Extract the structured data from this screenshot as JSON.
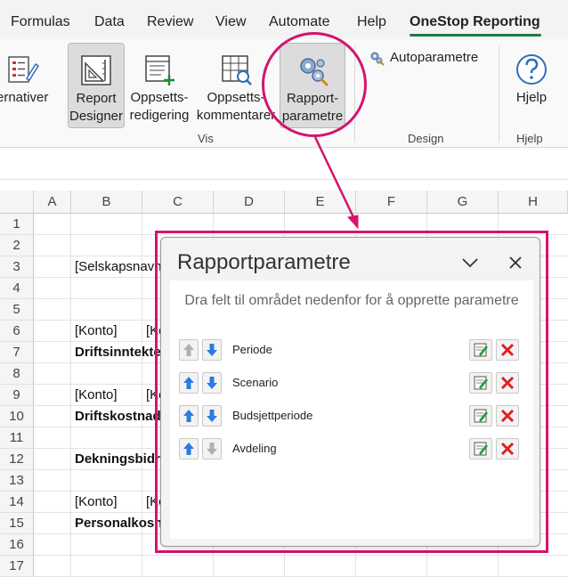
{
  "ribbon": {
    "tabs": [
      "Formulas",
      "Data",
      "Review",
      "View",
      "Automate",
      "Help",
      "OneStop Reporting"
    ],
    "buttons": {
      "alternatives": "ernativer",
      "report_designer": "Report\nDesigner",
      "oppsett_redigering": "Oppsetts-\nredigering",
      "oppsett_kommentarer": "Oppsetts-\nkommentarer",
      "rapport_parametre": "Rapport-\nparametre",
      "autoparametre": "Autoparametre",
      "hjelp": "Hjelp"
    },
    "groups": {
      "vis": "Vis",
      "design": "Design",
      "hjelp": "Hjelp"
    },
    "accent": "#1f7a44"
  },
  "grid": {
    "columns": [
      "A",
      "B",
      "C",
      "D",
      "E",
      "F",
      "G",
      "H"
    ],
    "rows": [
      "1",
      "2",
      "3",
      "4",
      "5",
      "6",
      "7",
      "8",
      "9",
      "10",
      "11",
      "12",
      "13",
      "14",
      "15",
      "16",
      "17"
    ],
    "cells": {
      "b3": "[Selskapsnavn",
      "b6": "[Konto]",
      "c6": "[Ko",
      "b7": "Driftsinntekte",
      "b9": "[Konto]",
      "c9": "[Ko",
      "b10": "Driftskostnad",
      "b12": "Dekningsbidr",
      "b14": "[Konto]",
      "c14": "[Ko",
      "b15": "Personalkosn"
    }
  },
  "panel": {
    "title": "Rapportparametre",
    "hint": "Dra felt til området nedenfor for å opprette parametre",
    "params": [
      {
        "label": "Periode",
        "up_enabled": false,
        "down_enabled": true
      },
      {
        "label": "Scenario",
        "up_enabled": true,
        "down_enabled": true
      },
      {
        "label": "Budsjettperiode",
        "up_enabled": true,
        "down_enabled": true
      },
      {
        "label": "Avdeling",
        "up_enabled": true,
        "down_enabled": false
      }
    ]
  },
  "callout_color": "#d4146e"
}
